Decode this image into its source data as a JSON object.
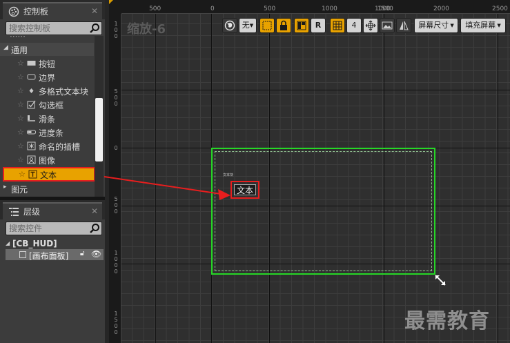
{
  "palette": {
    "title": "控制板",
    "search_placeholder": "搜索控制板",
    "categories": [
      {
        "label": "通用"
      },
      {
        "label": "图元"
      }
    ],
    "items": [
      {
        "label": "按钮",
        "icon": "button-icon"
      },
      {
        "label": "边界",
        "icon": "border-icon"
      },
      {
        "label": "多格式文本块",
        "icon": "rich-text-icon"
      },
      {
        "label": "勾选框",
        "icon": "checkbox-icon"
      },
      {
        "label": "滑条",
        "icon": "slider-icon"
      },
      {
        "label": "进度条",
        "icon": "progress-bar-icon"
      },
      {
        "label": "命名的插槽",
        "icon": "named-slot-icon"
      },
      {
        "label": "图像",
        "icon": "image-icon"
      },
      {
        "label": "文本",
        "icon": "text-icon",
        "selected": true
      }
    ]
  },
  "hierarchy": {
    "title": "层级",
    "search_placeholder": "搜索控件",
    "root": "[CB_HUD]",
    "child": "[画布面板]"
  },
  "designer": {
    "zoom_label": "缩放-6",
    "ruler_top": [
      "500",
      "0",
      "500",
      "1000",
      "1500",
      "2000",
      "2500"
    ],
    "ruler_left": [
      "100",
      "500",
      "0",
      "500",
      "1000",
      "1500"
    ],
    "toolbar": {
      "localize_label": "无",
      "r_label": "R",
      "grid_size": "4",
      "screen_size_label": "屏幕尺寸",
      "fill_screen_label": "填充屏幕"
    },
    "canvas_small_label": "文本块",
    "text_widget_label": "文本"
  },
  "watermark": "最需教育",
  "colors": {
    "accent_orange": "#e8a200",
    "selection_red": "#e81e1e",
    "screen_green": "#26d826"
  }
}
